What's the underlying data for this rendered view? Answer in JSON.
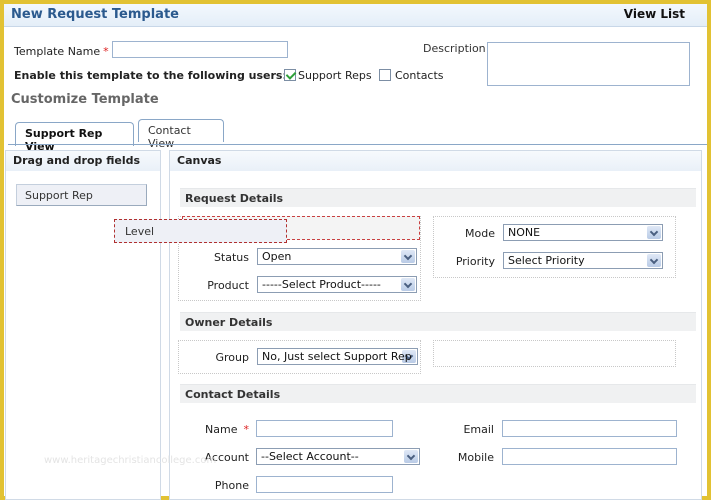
{
  "header": {
    "title": "New Request Template",
    "view_list": "View List"
  },
  "form": {
    "template_name_label": "Template Name",
    "required_mark": "*",
    "template_name_value": "",
    "description_label": "Description",
    "description_value": "",
    "enable_label": "Enable this template to the following users:",
    "checkboxes": [
      {
        "label": "Support Reps",
        "checked": true
      },
      {
        "label": "Contacts",
        "checked": false
      }
    ]
  },
  "customize_heading": "Customize Template",
  "tabs": [
    {
      "label": "Support Rep View",
      "active": true
    },
    {
      "label": "Contact View",
      "active": false
    }
  ],
  "fields_panel": {
    "title": "Drag and drop fields",
    "items": [
      "Support Rep"
    ],
    "dragging": "Level"
  },
  "canvas": {
    "title": "Canvas",
    "sections": {
      "request": {
        "title": "Request Details",
        "status_label": "Status",
        "status_value": "Open",
        "product_label": "Product",
        "product_value": "-----Select Product-----",
        "mode_label": "Mode",
        "mode_value": "NONE",
        "priority_label": "Priority",
        "priority_value": "Select Priority"
      },
      "owner": {
        "title": "Owner Details",
        "group_label": "Group",
        "group_value": "No, Just select Support Rep"
      },
      "contact": {
        "title": "Contact Details",
        "name_label": "Name",
        "name_value": "",
        "account_label": "Account",
        "account_value": "--Select Account--",
        "phone_label": "Phone",
        "phone_value": "",
        "email_label": "Email",
        "email_value": "",
        "mobile_label": "Mobile",
        "mobile_value": ""
      }
    }
  },
  "watermark": "www.heritagechristiancollege.com",
  "colors": {
    "frame": "#e2c233",
    "title": "#2b5a8e",
    "required": "#dd2222"
  }
}
